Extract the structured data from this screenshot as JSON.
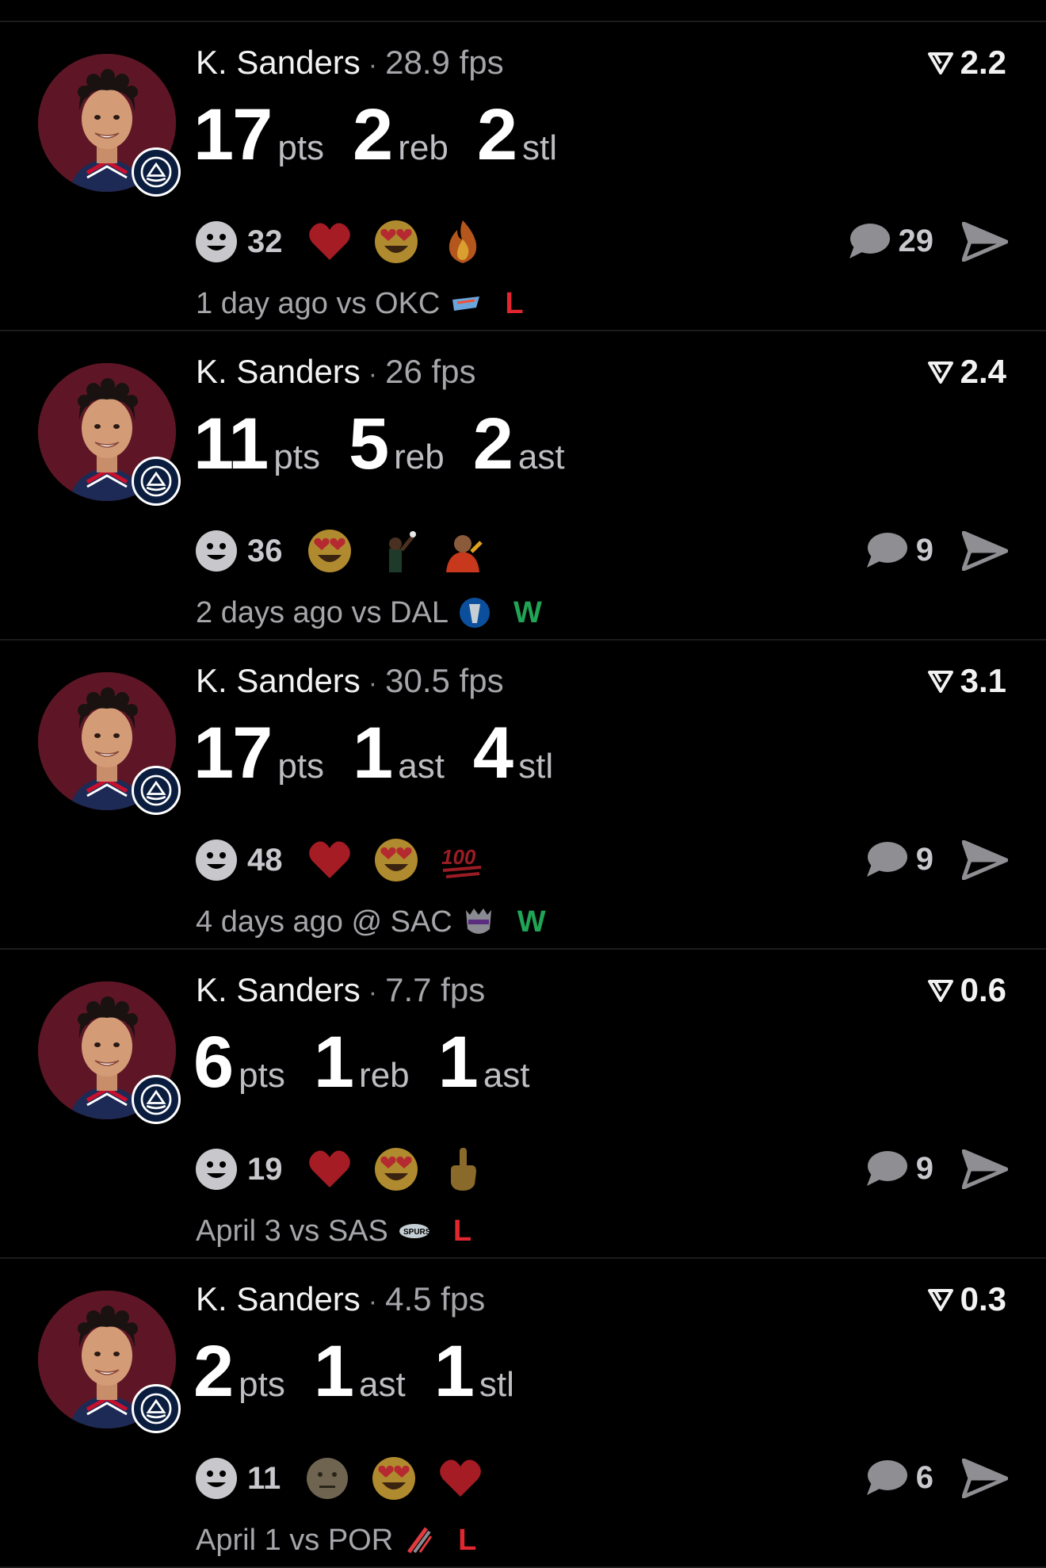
{
  "feed": {
    "posts": [
      {
        "player": "K. Sanders",
        "separator": "·",
        "fps": "28.9 fps",
        "score": "2.2",
        "stats": [
          {
            "value": "17",
            "unit": "pts"
          },
          {
            "value": "2",
            "unit": "reb"
          },
          {
            "value": "2",
            "unit": "stl"
          }
        ],
        "reaction_count": "32",
        "emojis": [
          "heart-icon",
          "heart-eyes-icon",
          "fire-icon"
        ],
        "comment_count": "29",
        "meta": "1 day ago vs OKC",
        "team_logo": "okc-logo-icon",
        "result": "L"
      },
      {
        "player": "K. Sanders",
        "separator": "·",
        "fps": "26 fps",
        "score": "2.4",
        "stats": [
          {
            "value": "11",
            "unit": "pts"
          },
          {
            "value": "5",
            "unit": "reb"
          },
          {
            "value": "2",
            "unit": "ast"
          }
        ],
        "reaction_count": "36",
        "emojis": [
          "heart-eyes-icon",
          "player-reaction-icon",
          "drake-reaction-icon"
        ],
        "comment_count": "9",
        "meta": "2 days ago vs DAL",
        "team_logo": "dal-logo-icon",
        "result": "W"
      },
      {
        "player": "K. Sanders",
        "separator": "·",
        "fps": "30.5 fps",
        "score": "3.1",
        "stats": [
          {
            "value": "17",
            "unit": "pts"
          },
          {
            "value": "1",
            "unit": "ast"
          },
          {
            "value": "4",
            "unit": "stl"
          }
        ],
        "reaction_count": "48",
        "emojis": [
          "heart-icon",
          "heart-eyes-icon",
          "hundred-icon"
        ],
        "comment_count": "9",
        "meta": "4 days ago @ SAC",
        "team_logo": "sac-logo-icon",
        "result": "W"
      },
      {
        "player": "K. Sanders",
        "separator": "·",
        "fps": "7.7 fps",
        "score": "0.6",
        "stats": [
          {
            "value": "6",
            "unit": "pts"
          },
          {
            "value": "1",
            "unit": "reb"
          },
          {
            "value": "1",
            "unit": "ast"
          }
        ],
        "reaction_count": "19",
        "emojis": [
          "heart-icon",
          "heart-eyes-icon",
          "middle-finger-icon"
        ],
        "comment_count": "9",
        "meta": "April 3 vs SAS",
        "team_logo": "sas-logo-icon",
        "result": "L"
      },
      {
        "player": "K. Sanders",
        "separator": "·",
        "fps": "4.5 fps",
        "score": "0.3",
        "stats": [
          {
            "value": "2",
            "unit": "pts"
          },
          {
            "value": "1",
            "unit": "ast"
          },
          {
            "value": "1",
            "unit": "stl"
          }
        ],
        "reaction_count": "11",
        "emojis": [
          "neutral-face-icon",
          "heart-eyes-icon",
          "heart-icon"
        ],
        "comment_count": "6",
        "meta": "April 1 vs POR",
        "team_logo": "por-logo-icon",
        "result": "L"
      }
    ]
  },
  "colors": {
    "background": "#000000",
    "loss": "#e0272f",
    "win": "#20a455",
    "avatar_bg": "#5a1524"
  }
}
